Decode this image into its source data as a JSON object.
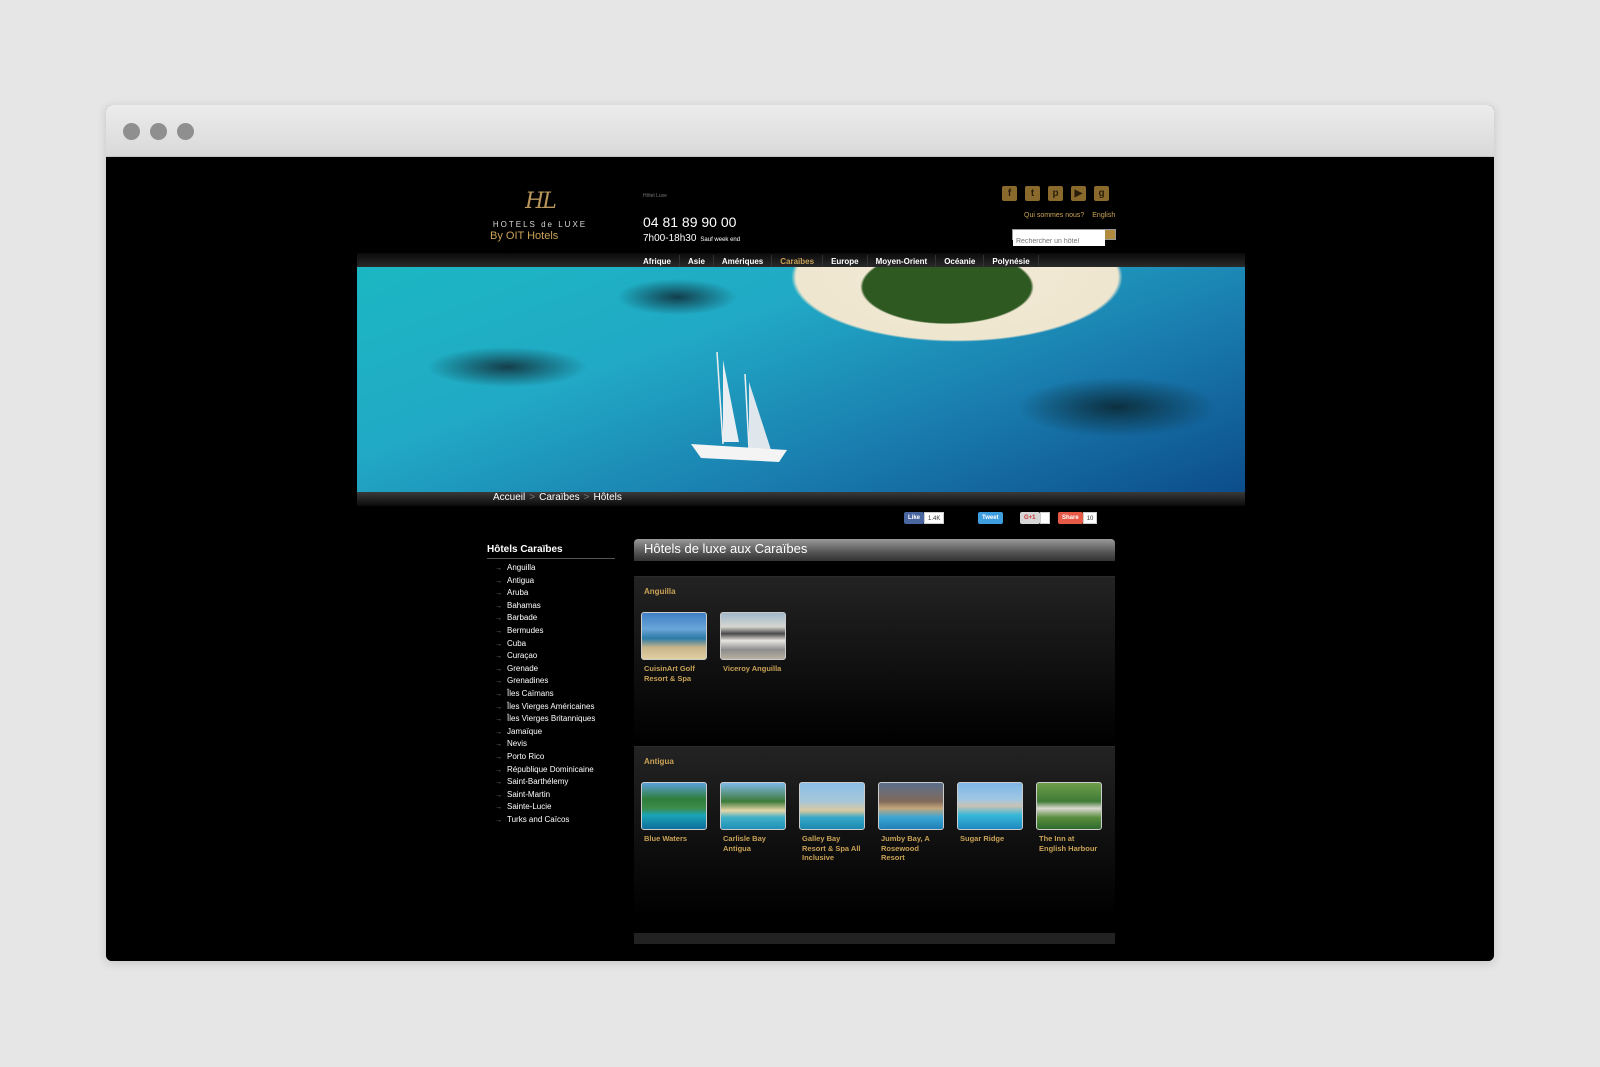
{
  "logo": {
    "mark": "HL",
    "text": "HOTELS de LUXE",
    "by": "By OIT Hotels"
  },
  "header": {
    "tagline": "Hôtel Luxe",
    "phone": "04 81 89 90 00",
    "hours": "7h00-18h30",
    "hours_note": "Sauf week end",
    "about_link": "Qui sommes nous?",
    "lang_link": "English",
    "search_placeholder": "Rechercher un hôtel"
  },
  "social": [
    "facebook-icon",
    "twitter-icon",
    "pinterest-icon",
    "youtube-icon",
    "googleplus-icon"
  ],
  "nav": [
    {
      "label": "Afrique"
    },
    {
      "label": "Asie"
    },
    {
      "label": "Amériques"
    },
    {
      "label": "Caraïbes",
      "active": true
    },
    {
      "label": "Europe"
    },
    {
      "label": "Moyen-Orient"
    },
    {
      "label": "Océanie"
    },
    {
      "label": "Polynésie"
    }
  ],
  "breadcrumb": [
    "Accueil",
    "Caraïbes",
    "Hôtels"
  ],
  "share": {
    "like_label": "Like",
    "like_count": "1.4K",
    "tweet_label": "Tweet",
    "gplus_label": "G+1",
    "share_label": "Share",
    "share_count": "10"
  },
  "sidebar": {
    "title": "Hôtels Caraïbes",
    "items": [
      "Anguilla",
      "Antigua",
      "Aruba",
      "Bahamas",
      "Barbade",
      "Bermudes",
      "Cuba",
      "Curaçao",
      "Grenade",
      "Grenadines",
      "Îles Caïmans",
      "Îles Vierges Américaines",
      "Îles Vierges Britanniques",
      "Jamaïque",
      "Nevis",
      "Porto Rico",
      "République Dominicaine",
      "Saint-Barthélemy",
      "Saint-Martin",
      "Sainte-Lucie",
      "Turks and Caïcos"
    ]
  },
  "main": {
    "title": "Hôtels de luxe aux Caraïbes",
    "sections": [
      {
        "name": "Anguilla",
        "hotels": [
          "CuisinArt Golf Resort & Spa",
          "Viceroy Anguilla"
        ]
      },
      {
        "name": "Antigua",
        "hotels": [
          "Blue Waters",
          "Carlisle Bay Antigua",
          "Galley Bay Resort & Spa All Inclusive",
          "Jumby Bay, A Rosewood Resort",
          "Sugar Ridge",
          "The Inn at English Harbour"
        ]
      }
    ]
  },
  "colors": {
    "accent": "#c9a256",
    "background": "#000000"
  }
}
